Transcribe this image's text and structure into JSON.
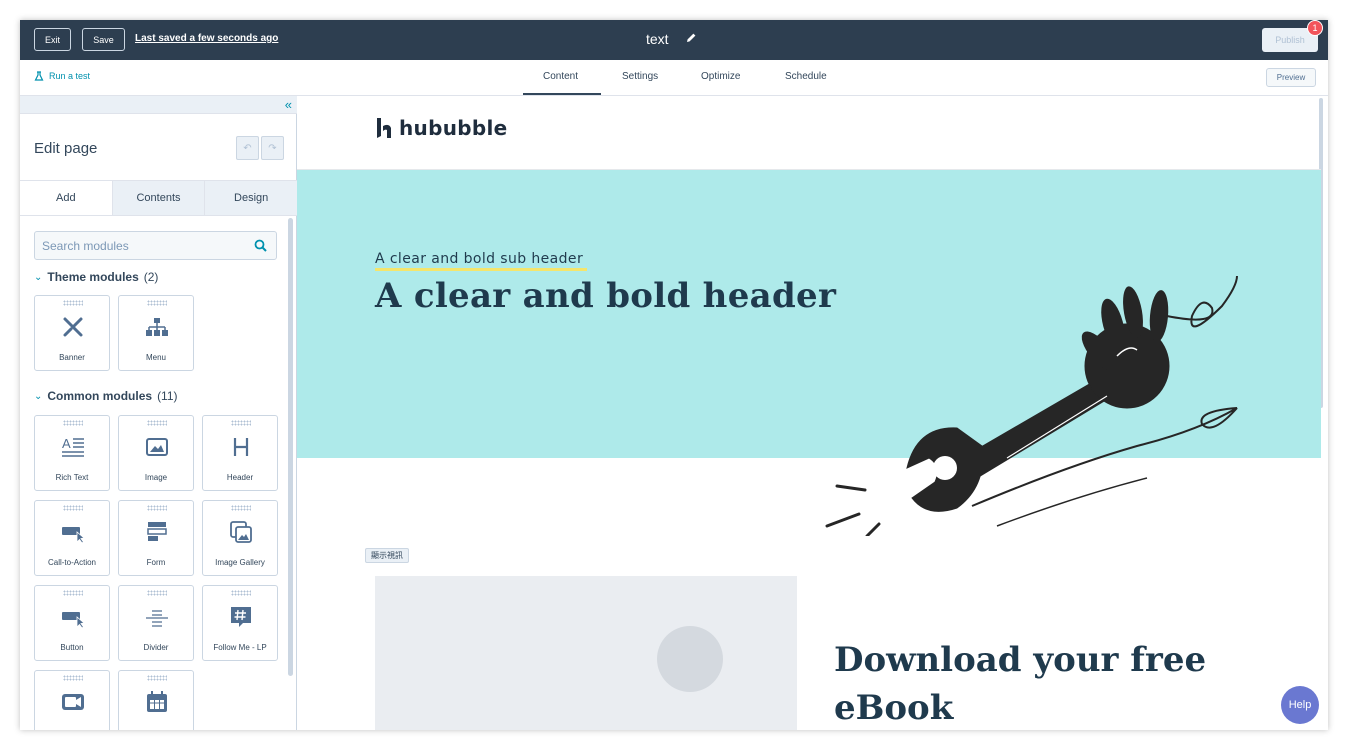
{
  "topbar": {
    "exit_label": "Exit",
    "save_label": "Save",
    "saved_status": "Last saved a few seconds ago",
    "page_name": "text",
    "publish_label": "Publish",
    "notification_count": "1"
  },
  "tabbar": {
    "run_test_label": "Run a test",
    "tabs": [
      {
        "label": "Content",
        "active": true
      },
      {
        "label": "Settings",
        "active": false
      },
      {
        "label": "Optimize",
        "active": false
      },
      {
        "label": "Schedule",
        "active": false
      }
    ],
    "preview_label": "Preview"
  },
  "sidebar": {
    "collapse_icon": "«",
    "title": "Edit page",
    "tabs": [
      {
        "label": "Add",
        "active": true
      },
      {
        "label": "Contents",
        "active": false
      },
      {
        "label": "Design",
        "active": false
      }
    ],
    "search_placeholder": "Search modules",
    "theme_section": {
      "label": "Theme modules",
      "count": "(2)"
    },
    "theme_modules": [
      {
        "label": "Banner",
        "icon": "tools-icon"
      },
      {
        "label": "Menu",
        "icon": "sitemap-icon"
      }
    ],
    "common_section": {
      "label": "Common modules",
      "count": "(11)"
    },
    "common_modules": [
      {
        "label": "Rich Text",
        "icon": "rich-text-icon"
      },
      {
        "label": "Image",
        "icon": "image-icon"
      },
      {
        "label": "Header",
        "icon": "header-icon"
      },
      {
        "label": "Call-to-Action",
        "icon": "cta-icon"
      },
      {
        "label": "Form",
        "icon": "form-icon"
      },
      {
        "label": "Image Gallery",
        "icon": "gallery-icon"
      },
      {
        "label": "Button",
        "icon": "button-icon"
      },
      {
        "label": "Divider",
        "icon": "divider-icon"
      },
      {
        "label": "Follow Me - LP",
        "icon": "hashtag-icon"
      },
      {
        "label": "",
        "icon": "video-icon"
      },
      {
        "label": "",
        "icon": "calendar-icon"
      }
    ]
  },
  "canvas": {
    "logo_text": "hububble",
    "subheader": "A clear and bold sub header",
    "header": "A clear and bold header",
    "chip_label": "顯示視訊",
    "ebook_title": "Download your free eBook",
    "help_label": "Help",
    "hero_color": "#aeeaea"
  }
}
